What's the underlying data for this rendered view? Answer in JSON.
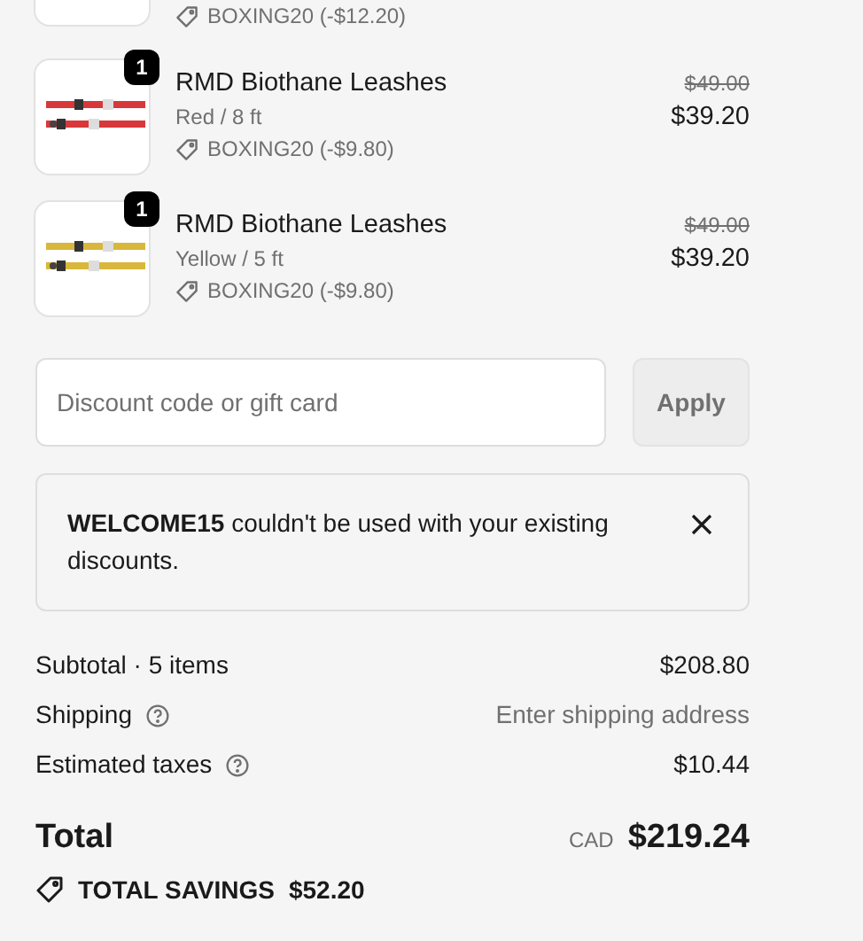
{
  "items": [
    {
      "kind": "partial",
      "discount": "BOXING20 (-$12.20)"
    },
    {
      "kind": "full",
      "quantity": "1",
      "color": "#d8383a",
      "name": "RMD Biothane Leashes",
      "variant": "Red / 8 ft",
      "discount": "BOXING20 (-$9.80)",
      "original_price": "$49.00",
      "price": "$39.20"
    },
    {
      "kind": "full",
      "quantity": "1",
      "color": "#d9b73c",
      "name": "RMD Biothane Leashes",
      "variant": "Yellow / 5 ft",
      "discount": "BOXING20 (-$9.80)",
      "original_price": "$49.00",
      "price": "$39.20"
    }
  ],
  "discount_field": {
    "placeholder": "Discount code or gift card",
    "button": "Apply",
    "disabled": true
  },
  "alert": {
    "message": "**WELCOME15** couldn't be used with your existing discounts."
  },
  "summary": [
    {
      "label": "Subtotal · 5 items",
      "help": false,
      "value": "$208.80",
      "muted": false
    },
    {
      "label": "Shipping",
      "help": true,
      "value": "Enter shipping address",
      "muted": true
    },
    {
      "label": "Estimated taxes",
      "help": true,
      "value": "$10.44",
      "muted": false
    }
  ],
  "total": {
    "label": "Total",
    "currency": "CAD",
    "amount": "$219.24"
  },
  "savings": {
    "label": "TOTAL SAVINGS",
    "amount": "$52.20"
  }
}
